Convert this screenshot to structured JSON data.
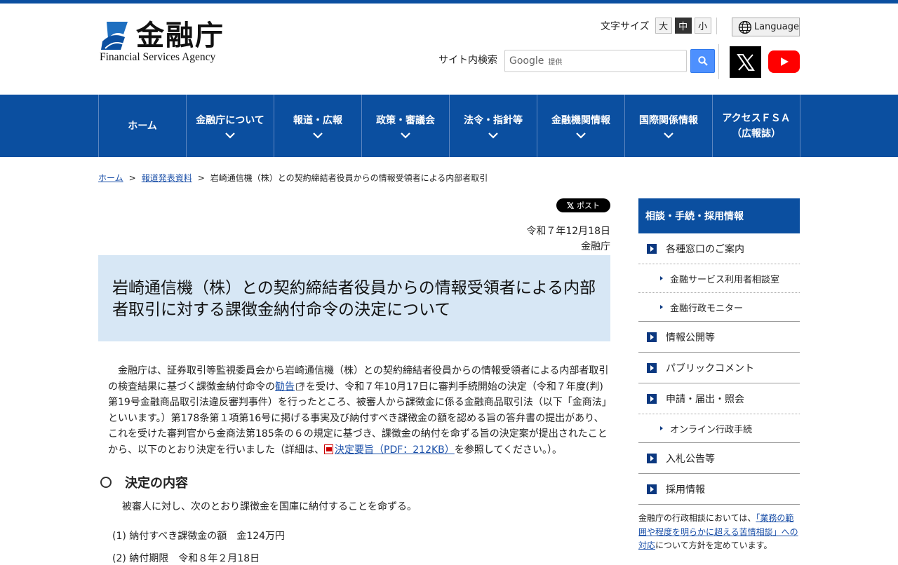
{
  "header": {
    "logo_jp": "金融庁",
    "logo_en": "Financial Services Agency",
    "font_size_label": "文字サイズ",
    "font_sizes": [
      "大",
      "中",
      "小"
    ],
    "language_label": "Language",
    "search_label": "サイト内検索",
    "search_google": "Google",
    "search_provided": "提供"
  },
  "nav": {
    "items": [
      {
        "label": "ホーム"
      },
      {
        "label": "金融庁について"
      },
      {
        "label": "報道・広報"
      },
      {
        "label": "政策・審議会"
      },
      {
        "label": "法令・指針等"
      },
      {
        "label": "金融機関情報"
      },
      {
        "label": "国際関係情報"
      },
      {
        "label": "アクセスＦＳＡ",
        "label2": "（広報誌）"
      }
    ]
  },
  "breadcrumb": {
    "home": "ホーム",
    "press": "報道発表資料",
    "current": "岩崎通信機（株）との契約締結者役員からの情報受領者による内部者取引"
  },
  "post_label": "ポスト",
  "date": "令和７年12月18日",
  "issuer": "金融庁",
  "title": "岩崎通信機（株）との契約締結者役員からの情報受領者による内部者取引に対する課徴金納付命令の決定について",
  "body": {
    "p1_a": "金融庁は、証券取引等監視委員会から岩崎通信機（株）との契約締結者役員からの情報受領者による内部者取引の検査結果に基づく課徴金納付命令の",
    "p1_link": "勧告",
    "p1_b": "を受け、令和７年10月17日に審判手続開始の決定（令和７年度(判)第19号金融商品取引法違反審判事件）を行ったところ、被審人から課徴金に係る金融商品取引法（以下「金商法」といいます。）第178条第１項第16号に掲げる事実及び納付すべき課徴金の額を認める旨の答弁書の提出があり、これを受けた審判官から金商法第185条の６の規定に基づき、課徴金の納付を命ずる旨の決定案が提出されたことから、以下のとおり決定を行いました（詳細は、",
    "p1_pdf": "決定要旨（PDF：212KB）",
    "p1_c": "を参照してください。）。",
    "section_title": "決定の内容",
    "p2": "被審人に対し、次のとおり課徴金を国庫に納付することを命ずる。",
    "item1": "(1) 納付すべき課徴金の額　金124万円",
    "item2": "(2) 納付期限　令和８年２月18日"
  },
  "sidebar": {
    "heading": "相談・手続・採用情報",
    "items": {
      "i1": "各種窓口のご案内",
      "s1": "金融サービス利用者相談室",
      "s2": "金融行政モニター",
      "i2": "情報公開等",
      "i3": "パブリックコメント",
      "i4": "申請・届出・照会",
      "s3": "オンライン行政手続",
      "i5": "入札公告等",
      "i6": "採用情報"
    },
    "note_a": "金融庁の行政相談においては、",
    "note_link": "「業務の範囲や程度を明らかに超える苦情相談」への対応",
    "note_b": "について方針を定めています。"
  },
  "colors": {
    "brand_blue": "#0b4fa0",
    "title_bg": "#d7e7f5",
    "link": "#1a4fa8"
  }
}
